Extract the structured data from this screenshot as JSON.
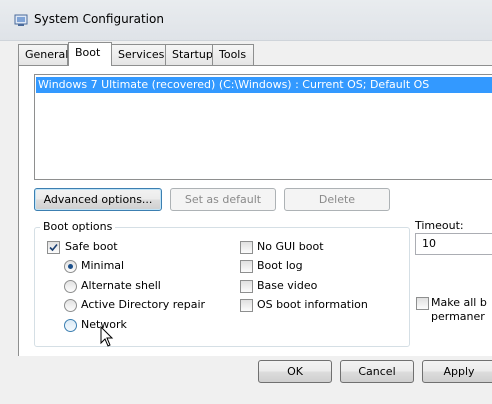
{
  "window": {
    "title": "System Configuration"
  },
  "tabs": [
    "General",
    "Boot",
    "Services",
    "Startup",
    "Tools"
  ],
  "boot_entries": [
    "Windows 7 Ultimate (recovered)  (C:\\Windows) : Current OS; Default OS"
  ],
  "buttons": {
    "advanced": "Advanced options...",
    "set_default": "Set as default",
    "delete": "Delete"
  },
  "boot_options": {
    "label": "Boot options",
    "safe_boot": {
      "label": "Safe boot",
      "checked": true
    },
    "safe_modes": [
      {
        "label": "Minimal",
        "selected": true
      },
      {
        "label": "Alternate shell",
        "selected": false
      },
      {
        "label": "Active Directory repair",
        "selected": false
      },
      {
        "label": "Network",
        "selected": false
      }
    ],
    "right_options": [
      {
        "label": "No GUI boot",
        "checked": false
      },
      {
        "label": "Boot log",
        "checked": false
      },
      {
        "label": "Base video",
        "checked": false
      },
      {
        "label": "OS boot information",
        "checked": false
      }
    ]
  },
  "timeout": {
    "label": "Timeout:",
    "value": "10"
  },
  "make_permanent": {
    "line1": "Make all b",
    "line2": "permaner",
    "checked": false
  },
  "footer": {
    "ok": "OK",
    "cancel": "Cancel",
    "apply": "Apply"
  }
}
